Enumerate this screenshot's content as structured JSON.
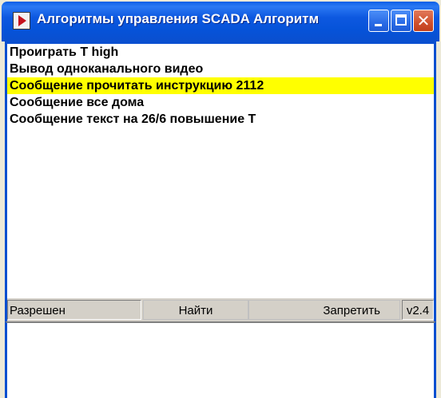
{
  "window": {
    "title": "Алгоритмы управления SCADA Алгоритм",
    "icon": "app-icon"
  },
  "list": {
    "items": [
      {
        "label": "Проиграть T high",
        "selected": false
      },
      {
        "label": "Вывод одноканального видео",
        "selected": false
      },
      {
        "label": "Сообщение прочитать инструкцию 2112",
        "selected": true
      },
      {
        "label": "Сообщение все дома",
        "selected": false
      },
      {
        "label": "Сообщение текст на 26/6 повышение Т",
        "selected": false
      }
    ]
  },
  "statusbar": {
    "status": "Разрешен",
    "find_label": "Найти",
    "deny_label": "Запретить",
    "version": "v2.4"
  },
  "colors": {
    "selection": "#ffff00",
    "titlebar": "#0a5ee6",
    "window_border": "#0a4fd0"
  }
}
